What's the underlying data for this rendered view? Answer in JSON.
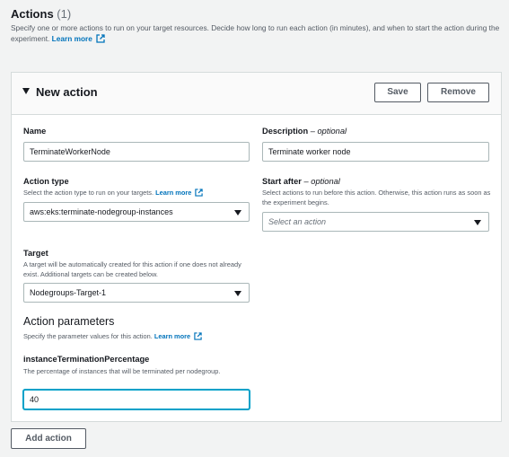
{
  "header": {
    "title": "Actions",
    "count": "(1)",
    "description": "Specify one or more actions to run on your target resources. Decide how long to run each action (in minutes), and when to start the action during the experiment.",
    "learn_more": "Learn more"
  },
  "card": {
    "title": "New action",
    "save_label": "Save",
    "remove_label": "Remove"
  },
  "fields": {
    "name": {
      "label": "Name",
      "value": "TerminateWorkerNode"
    },
    "description": {
      "label": "Description",
      "optional": "optional",
      "value": "Terminate worker node"
    },
    "action_type": {
      "label": "Action type",
      "description": "Select the action type to run on your targets.",
      "learn_more": "Learn more",
      "value": "aws:eks:terminate-nodegroup-instances"
    },
    "start_after": {
      "label": "Start after",
      "optional": "optional",
      "description": "Select actions to run before this action. Otherwise, this action runs as soon as the experiment begins.",
      "placeholder": "Select an action"
    },
    "target": {
      "label": "Target",
      "description": "A target will be automatically created for this action if one does not already exist. Additional targets can be created below.",
      "value": "Nodegroups-Target-1"
    }
  },
  "action_parameters": {
    "title": "Action parameters",
    "description": "Specify the parameter values for this action.",
    "learn_more": "Learn more",
    "param": {
      "label": "instanceTerminationPercentage",
      "description": "The percentage of instances that will be terminated per nodegroup.",
      "value": "40"
    }
  },
  "footer": {
    "add_action_label": "Add action"
  },
  "colors": {
    "link": "#0073bb",
    "focus": "#00a1c9"
  },
  "icons": {
    "external_link": "external-link-icon",
    "caret": "caret-down-icon",
    "select_arrow": "dropdown-arrow-icon"
  }
}
